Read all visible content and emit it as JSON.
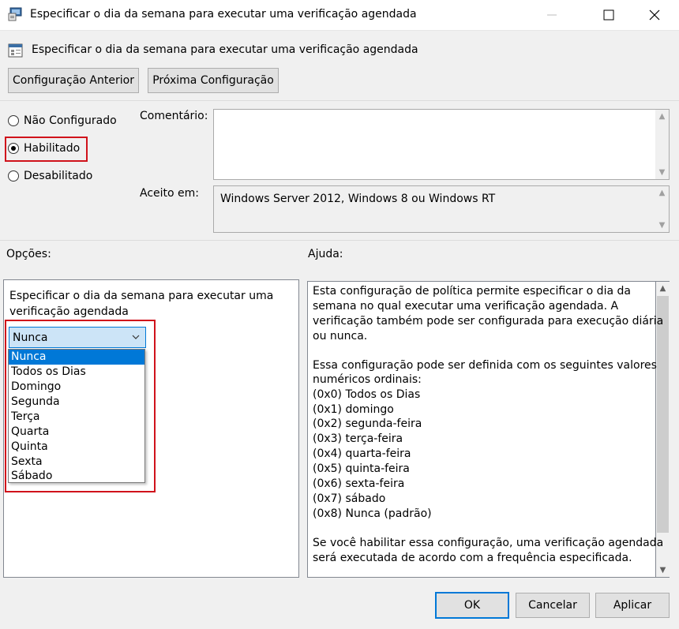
{
  "window": {
    "title": "Especificar o dia da semana para executar uma verificação agendada"
  },
  "header": {
    "title": "Especificar o dia da semana para executar uma verificação agendada",
    "prev_label": "Configuração Anterior",
    "next_label": "Próxima Configuração"
  },
  "state": {
    "options": [
      {
        "label": "Não Configurado",
        "selected": false
      },
      {
        "label": "Habilitado",
        "selected": true
      },
      {
        "label": "Desabilitado",
        "selected": false
      }
    ]
  },
  "comment": {
    "label": "Comentário:",
    "value": ""
  },
  "supported": {
    "label": "Aceito em:",
    "value": "Windows Server 2012, Windows 8 ou Windows RT"
  },
  "options_section": {
    "label": "Opções:",
    "description_line1": "Especificar o dia da semana para executar uma",
    "description_line2": "verificação agendada",
    "combo_value": "Nunca",
    "dropdown_items": [
      "Nunca",
      "Todos os Dias",
      "Domingo",
      "Segunda",
      "Terça",
      "Quarta",
      "Quinta",
      "Sexta",
      "Sábado"
    ],
    "selected_index": 0
  },
  "help_section": {
    "label": "Ajuda:",
    "lines": [
      "Esta configuração de política permite especificar o dia da",
      "semana no qual executar uma verificação agendada. A",
      "verificação também pode ser configurada para execução diária",
      "ou nunca.",
      "",
      "Essa configuração pode ser definida com os seguintes valores",
      "numéricos ordinais:",
      "(0x0) Todos os Dias",
      "(0x1) domingo",
      "(0x2) segunda-feira",
      "(0x3) terça-feira",
      "(0x4) quarta-feira",
      "(0x5) quinta-feira",
      "(0x6) sexta-feira",
      "(0x7) sábado",
      "(0x8) Nunca (padrão)",
      "",
      "Se você habilitar essa configuração, uma verificação agendada",
      "será executada de acordo com a frequência especificada."
    ]
  },
  "footer": {
    "ok_label": "OK",
    "cancel_label": "Cancelar",
    "apply_label": "Aplicar"
  },
  "colors": {
    "highlight_red": "#d0121b",
    "accent_blue": "#0078d7"
  }
}
